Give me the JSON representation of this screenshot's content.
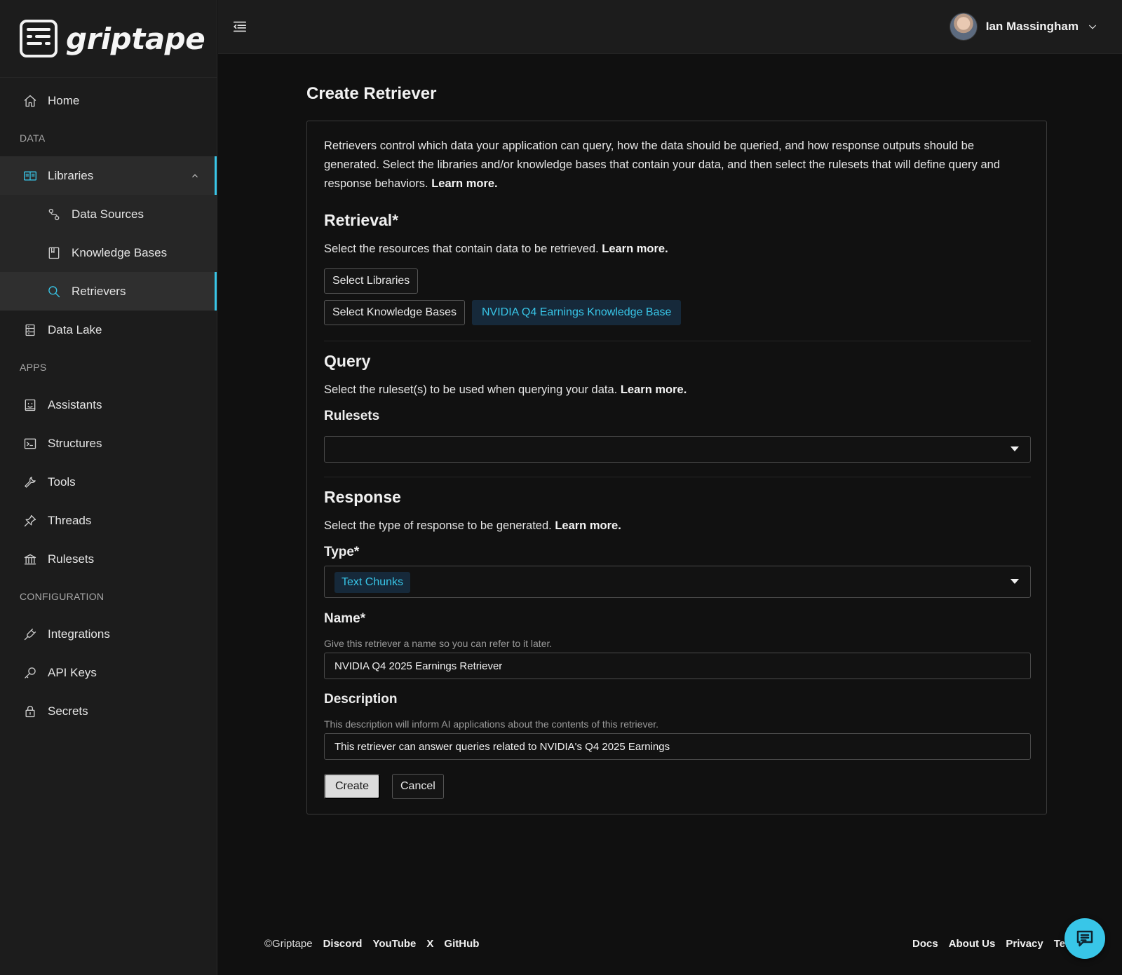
{
  "brand": {
    "name": "griptape"
  },
  "user": {
    "name": "Ian Massingham"
  },
  "sidebar": {
    "home": "Home",
    "section_data": "DATA",
    "libraries": "Libraries",
    "data_sources": "Data Sources",
    "knowledge_bases": "Knowledge Bases",
    "retrievers": "Retrievers",
    "data_lake": "Data Lake",
    "section_apps": "APPS",
    "assistants": "Assistants",
    "structures": "Structures",
    "tools": "Tools",
    "threads": "Threads",
    "rulesets": "Rulesets",
    "section_config": "CONFIGURATION",
    "integrations": "Integrations",
    "api_keys": "API Keys",
    "secrets": "Secrets"
  },
  "page": {
    "title": "Create Retriever",
    "intro": "Retrievers control which data your application can query, how the data should be queried, and how response outputs should be generated. Select the libraries and/or knowledge bases that contain your data, and then select the rulesets that will define query and response behaviors.",
    "learn_more": "Learn more."
  },
  "retrieval": {
    "heading": "Retrieval*",
    "desc": "Select the resources that contain data to be retrieved.",
    "select_libraries": "Select Libraries",
    "select_kbs": "Select Knowledge Bases",
    "selected_kb": "NVIDIA Q4 Earnings Knowledge Base"
  },
  "query": {
    "heading": "Query",
    "desc": "Select the ruleset(s) to be used when querying your data.",
    "rulesets_label": "Rulesets",
    "rulesets_value": ""
  },
  "response": {
    "heading": "Response",
    "desc": "Select the type of response to be generated.",
    "type_label": "Type*",
    "type_value": "Text Chunks",
    "name_label": "Name*",
    "name_hint": "Give this retriever a name so you can refer to it later.",
    "name_value": "NVIDIA Q4 2025 Earnings Retriever",
    "description_label": "Description",
    "description_hint": "This description will inform AI applications about the contents of this retriever.",
    "description_value": "This retriever can answer queries related to NVIDIA's Q4 2025 Earnings",
    "create": "Create",
    "cancel": "Cancel"
  },
  "footer": {
    "copyright": "©Griptape",
    "discord": "Discord",
    "youtube": "YouTube",
    "x": "X",
    "github": "GitHub",
    "docs": "Docs",
    "about": "About Us",
    "privacy": "Privacy",
    "terms": "Terms"
  },
  "colors": {
    "accent": "#38c6e8",
    "background": "#101010",
    "sidebar": "#1c1c1c"
  }
}
